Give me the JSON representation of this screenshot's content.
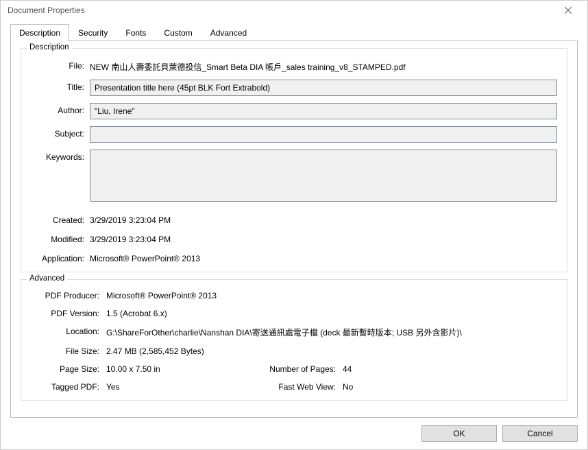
{
  "window": {
    "title": "Document Properties"
  },
  "tabs": {
    "description": "Description",
    "security": "Security",
    "fonts": "Fonts",
    "custom": "Custom",
    "advanced": "Advanced"
  },
  "groups": {
    "description": "Description",
    "advanced": "Advanced"
  },
  "labels": {
    "file": "File:",
    "title": "Title:",
    "author": "Author:",
    "subject": "Subject:",
    "keywords": "Keywords:",
    "created": "Created:",
    "modified": "Modified:",
    "application": "Application:",
    "pdf_producer": "PDF Producer:",
    "pdf_version": "PDF Version:",
    "location": "Location:",
    "file_size": "File Size:",
    "page_size": "Page Size:",
    "num_pages": "Number of Pages:",
    "tagged_pdf": "Tagged PDF:",
    "fast_web": "Fast Web View:"
  },
  "values": {
    "file": "NEW 南山人壽委託貝萊德投信_Smart Beta DIA 帳戶_sales training_v8_STAMPED.pdf",
    "title": "Presentation title here (45pt BLK Fort Extrabold)",
    "author": "\"Liu, Irene\"",
    "subject": "",
    "keywords": "",
    "created": "3/29/2019 3:23:04 PM",
    "modified": "3/29/2019 3:23:04 PM",
    "application": "Microsoft® PowerPoint® 2013",
    "pdf_producer": "Microsoft® PowerPoint® 2013",
    "pdf_version": "1.5 (Acrobat 6.x)",
    "location": "G:\\ShareForOther\\charlie\\Nanshan DIA\\寄送通訊處電子檔 (deck 最新暫時版本; USB 另外含影片)\\",
    "file_size": "2.47 MB (2,585,452 Bytes)",
    "page_size": "10.00 x 7.50 in",
    "num_pages": "44",
    "tagged_pdf": "Yes",
    "fast_web": "No"
  },
  "buttons": {
    "ok": "OK",
    "cancel": "Cancel"
  }
}
